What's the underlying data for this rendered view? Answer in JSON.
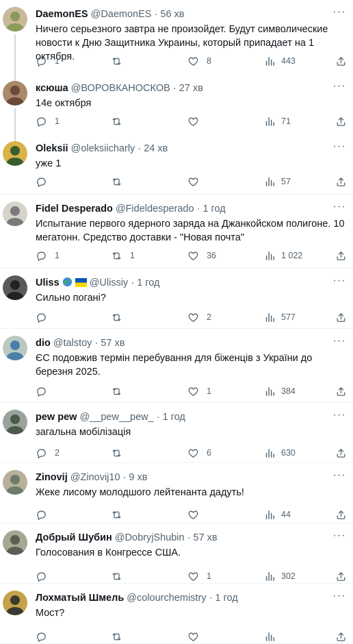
{
  "tweets": [
    {
      "name": "DaemonES",
      "handle": "@DaemonES",
      "dot": "·",
      "time": "56 хв",
      "text": "Ничего серьезного завтра не произойдет. Будут символические новости к Дню Защитника Украины, который припадает на 1 октября.",
      "replies": "1",
      "retweets": "",
      "likes": "8",
      "views": "443",
      "thread_below": true
    },
    {
      "name": "ксюша",
      "handle": "@ВОРОВКАНОСКОВ",
      "dot": "·",
      "time": "27 хв",
      "text": "14е октября",
      "replies": "1",
      "retweets": "",
      "likes": "",
      "views": "71",
      "thread_below": true
    },
    {
      "name": "Oleksii",
      "handle": "@oleksiicharly",
      "dot": "·",
      "time": "24 хв",
      "text": "уже 1",
      "replies": "",
      "retweets": "",
      "likes": "",
      "views": "57"
    },
    {
      "name": "Fidel Desperado",
      "handle": "@Fideldesperado",
      "dot": "·",
      "time": "1 год",
      "text": "Испытание первого ядерного заряда на Джанкойском полигоне. 10 мегатонн. Средство доставки - \"Новая почта\"",
      "replies": "1",
      "retweets": "1",
      "likes": "36",
      "views": "1 022"
    },
    {
      "name": "Uliss",
      "handle": "@Ulissiy",
      "dot": "·",
      "time": "1 год",
      "text": "Сильно погані?",
      "replies": "",
      "retweets": "",
      "likes": "2",
      "views": "577",
      "flags": true
    },
    {
      "name": "dio",
      "handle": "@talstoy",
      "dot": "·",
      "time": "57 хв",
      "text": "ЄС подовжив термін перебування для біженців з України до березня 2025.",
      "replies": "",
      "retweets": "",
      "likes": "1",
      "views": "384"
    },
    {
      "name": "pew pew",
      "handle": "@__pew__pew_",
      "dot": "·",
      "time": "1 год",
      "text": "загальна мобілізація",
      "replies": "2",
      "retweets": "",
      "likes": "6",
      "views": "630"
    },
    {
      "name": "Zinovij",
      "handle": "@Zinovij10",
      "dot": "·",
      "time": "9 хв",
      "text": "Жеке лисому молодшого лейтенанта дадуть!",
      "replies": "",
      "retweets": "",
      "likes": "",
      "views": "44"
    },
    {
      "name": "Добрый Шубин",
      "handle": "@DobryjShubin",
      "dot": "·",
      "time": "57 хв",
      "text": "Голосования в Конгрессе США.",
      "replies": "",
      "retweets": "",
      "likes": "1",
      "views": "302"
    },
    {
      "name": "Лохматый Шмель",
      "handle": "@colourchemistry",
      "dot": "·",
      "time": "1 год",
      "text": "Мост?",
      "replies": "",
      "retweets": "",
      "likes": "",
      "views": ""
    }
  ],
  "icons": {
    "more": "more-options-icon",
    "reply": "reply-icon",
    "retweet": "retweet-icon",
    "like": "like-icon",
    "views": "views-icon",
    "share": "share-icon"
  },
  "colors": {
    "text": "#0f1419",
    "secondary": "#536471",
    "separator": "#eff3f4",
    "thread": "#cfd9de"
  }
}
